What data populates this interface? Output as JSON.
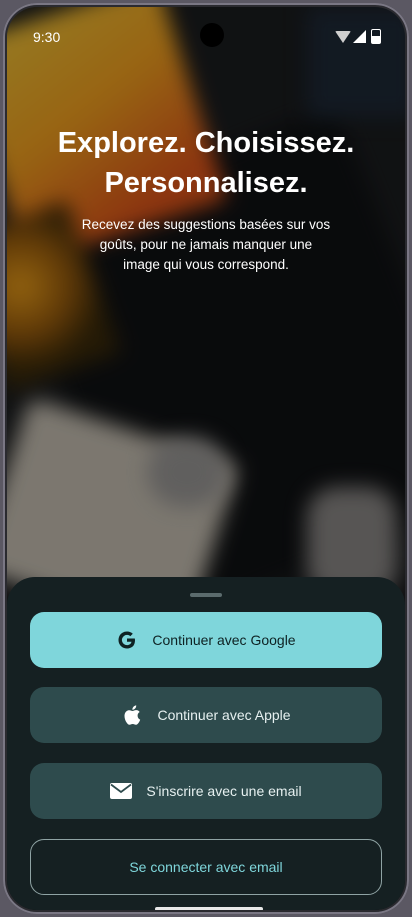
{
  "status_bar": {
    "time": "9:30"
  },
  "hero": {
    "headline_line1": "Explorez. Choisissez.",
    "headline_line2": "Personnalisez.",
    "subtitle": "Recevez des suggestions basées sur vos goûts, pour ne jamais manquer une image qui vous correspond."
  },
  "sheet": {
    "google_label": "Continuer avec Google",
    "apple_label": "Continuer avec Apple",
    "email_signup_label": "S'inscrire avec une email",
    "email_login_label": "Se connecter avec email"
  },
  "icons": {
    "google": "google-icon",
    "apple": "apple-icon",
    "email": "mail-icon"
  },
  "colors": {
    "primary_button": "#7fd6db",
    "secondary_button": "#2e4b4d",
    "sheet_background": "#152022",
    "outline_text": "#7fd6db"
  }
}
